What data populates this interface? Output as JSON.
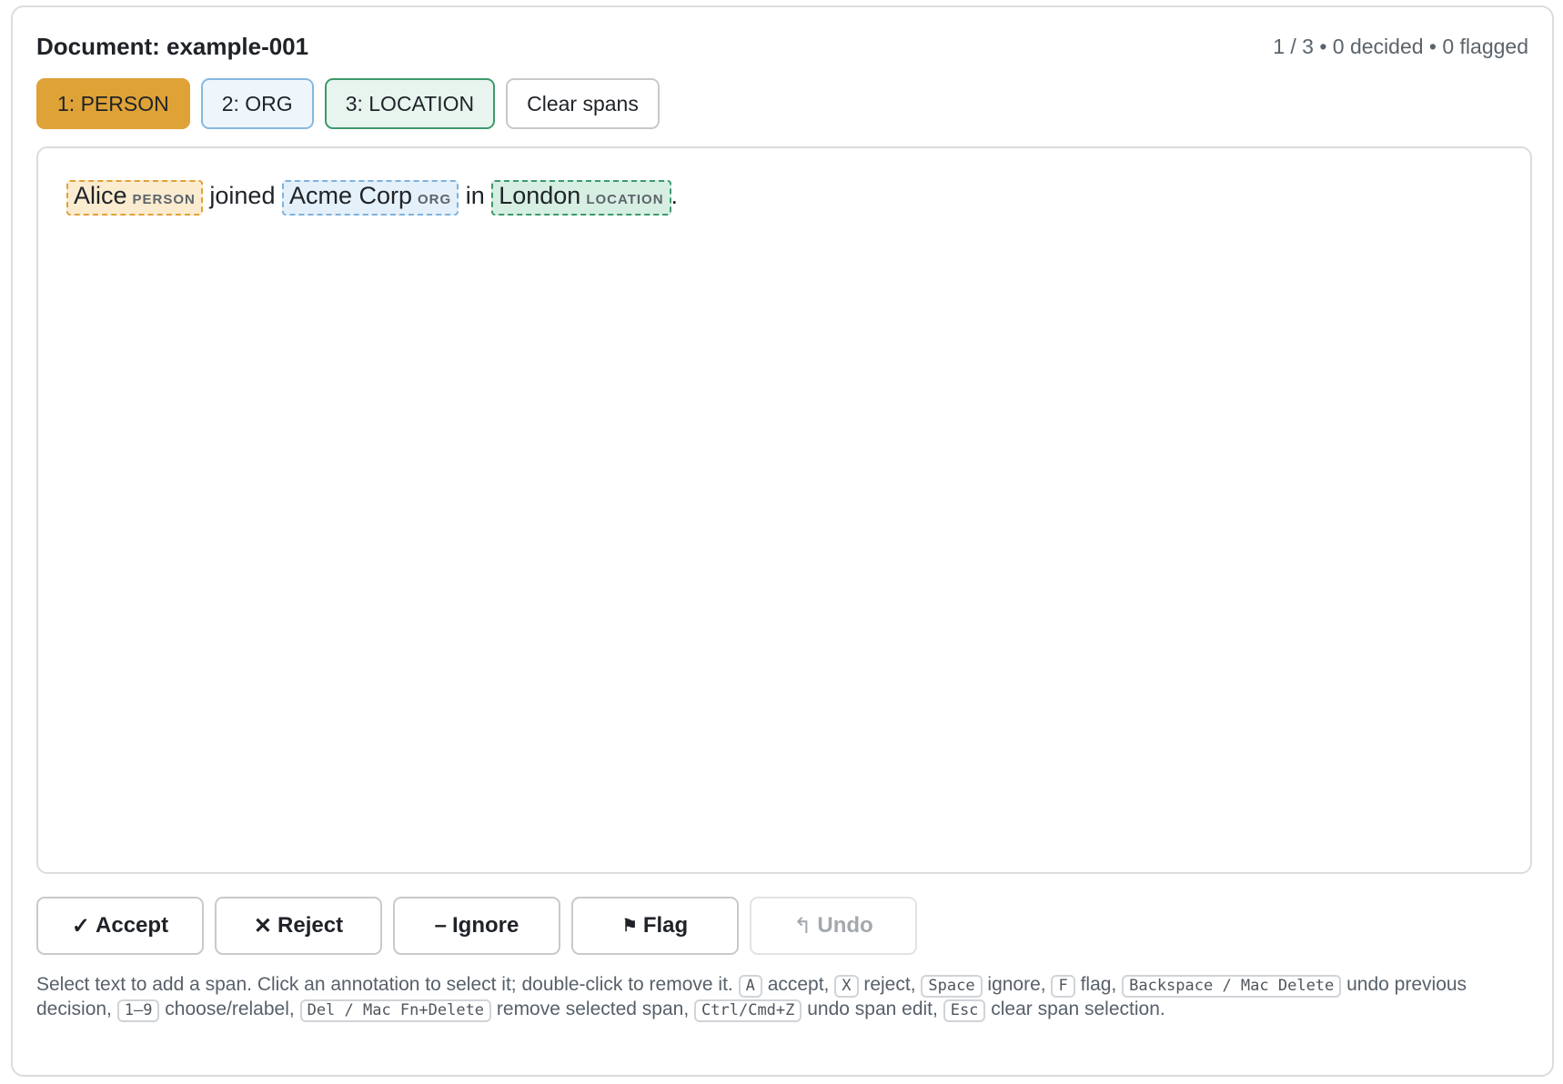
{
  "header": {
    "title": "Document: example-001",
    "progress": "1 / 3 • 0 decided • 0 flagged"
  },
  "labels": {
    "person": "1: PERSON",
    "org": "2: ORG",
    "location": "3: LOCATION",
    "clear": "Clear spans"
  },
  "document": {
    "spans": {
      "alice": {
        "text": "Alice",
        "tag": "PERSON"
      },
      "acme": {
        "text": "Acme Corp",
        "tag": "ORG"
      },
      "london": {
        "text": "London",
        "tag": "LOCATION"
      }
    },
    "t1": " joined ",
    "t2": " in ",
    "t3": "."
  },
  "actions": {
    "accept": {
      "icon": "✓",
      "label": "Accept"
    },
    "reject": {
      "icon": "✕",
      "label": "Reject"
    },
    "ignore": {
      "icon": "–",
      "label": "Ignore"
    },
    "flag": {
      "icon": "⚑",
      "label": "Flag"
    },
    "undo": {
      "icon": "↰",
      "label": "Undo"
    }
  },
  "help": {
    "t1": "Select text to add a span. Click an annotation to select it; double-click to remove it.",
    "k_accept": "A",
    "t_accept": "accept,",
    "k_reject": "X",
    "t_reject": "reject,",
    "k_ignore": "Space",
    "t_ignore": "ignore,",
    "k_flag": "F",
    "t_flag": "flag,",
    "k_undo": "Backspace / Mac Delete",
    "t_undo": "undo previous decision,",
    "k_label": "1–9",
    "t_label": "choose/relabel,",
    "k_remove": "Del / Mac Fn+Delete",
    "t_remove": "remove selected span,",
    "k_spanundo": "Ctrl/Cmd+Z",
    "t_spanundo": "undo span edit,",
    "k_esc": "Esc",
    "t_esc": "clear span selection."
  },
  "colors": {
    "person": "#dfa236",
    "org": "#86b9e0",
    "location": "#3d9a6c"
  }
}
